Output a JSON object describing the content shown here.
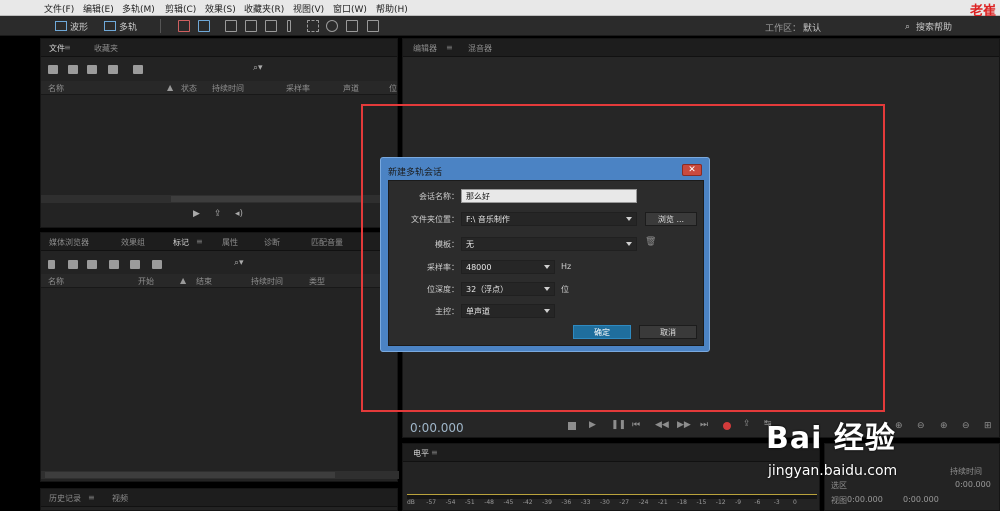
{
  "menu": [
    "文件(F)",
    "编辑(E)",
    "多轨(M)",
    "剪辑(C)",
    "效果(S)",
    "收藏夹(R)",
    "视图(V)",
    "窗口(W)",
    "帮助(H)"
  ],
  "logo_text": "老崔",
  "toolbar": {
    "waveform_label": "波形",
    "multitrack_label": "多轨",
    "workspace_label": "工作区：",
    "workspace_value": "默认",
    "search_help": "搜索帮助"
  },
  "files_panel": {
    "tabs": [
      "文件",
      "收藏夹"
    ],
    "columns": [
      "名称",
      "状态",
      "持续时间",
      "采样率",
      "声道",
      "位"
    ]
  },
  "media_panel": {
    "tabs": [
      "媒体浏览器",
      "效果组",
      "标记",
      "属性",
      "诊断",
      "匹配音量"
    ],
    "columns": [
      "名称",
      "开始",
      "结束",
      "持续时间",
      "类型"
    ]
  },
  "history_panel": {
    "tabs": [
      "历史记录",
      "视频"
    ]
  },
  "editor_panel": {
    "tabs": [
      "编辑器",
      "混音器"
    ]
  },
  "transport": {
    "time": "0:00.000"
  },
  "meter": {
    "title": "电平",
    "scale": [
      "dB",
      "-57",
      "-54",
      "-51",
      "-48",
      "-45",
      "-42",
      "-39",
      "-36",
      "-33",
      "-30",
      "-27",
      "-24",
      "-21",
      "-18",
      "-15",
      "-12",
      "-9",
      "-6",
      "-3",
      "0"
    ]
  },
  "selection_panel": {
    "header_end": "持续时间",
    "row_select_label": "选区",
    "row_view_label": "视图",
    "values": [
      "0:00.000",
      "0:00.000",
      "0:00.000"
    ]
  },
  "dialog": {
    "title": "新建多轨会话",
    "close_glyph": "✕",
    "session_name_label": "会话名称：",
    "session_name_value": "那么好",
    "folder_label": "文件夹位置：",
    "folder_value": "F:\\ 音乐制作",
    "browse_label": "浏览 ...",
    "template_label": "模板：",
    "template_value": "无",
    "sample_rate_label": "采样率：",
    "sample_rate_value": "48000",
    "sample_rate_unit": "Hz",
    "bit_depth_label": "位深度：",
    "bit_depth_value": "32（浮点）",
    "bit_depth_unit": "位",
    "master_label": "主控：",
    "master_value": "单声道",
    "ok_label": "确定",
    "cancel_label": "取消"
  },
  "watermark": {
    "brand": "Bai 经验",
    "url": "jingyan.baidu.com"
  }
}
